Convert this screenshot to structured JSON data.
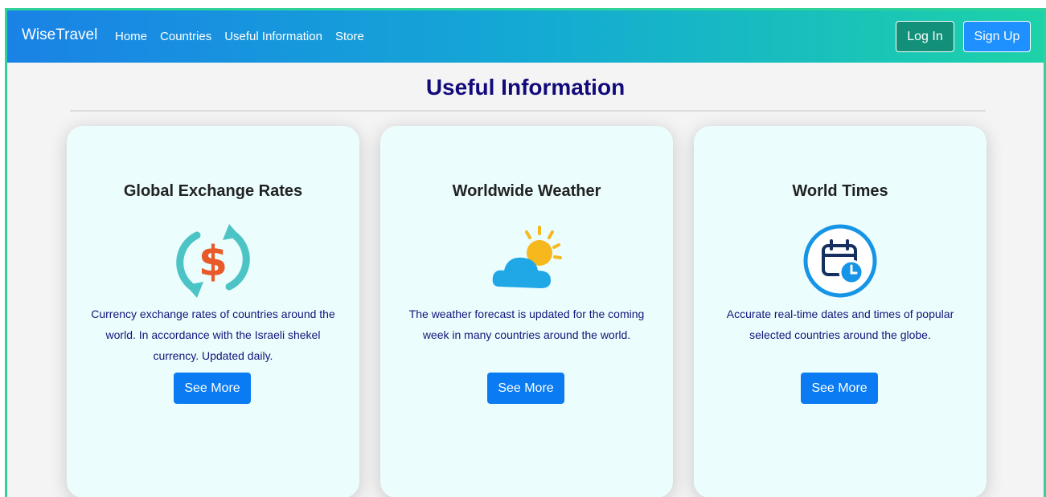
{
  "navbar": {
    "brand": "WiseTravel",
    "links": [
      "Home",
      "Countries",
      "Useful Information",
      "Store"
    ],
    "login_label": "Log In",
    "signup_label": "Sign Up"
  },
  "main": {
    "title": "Useful Information",
    "cards": [
      {
        "title": "Global Exchange Rates",
        "icon": "currency-exchange-icon",
        "description": "Currency exchange rates of countries around the world. In accordance with the Israeli shekel currency. Updated daily.",
        "button_label": "See More"
      },
      {
        "title": "Worldwide Weather",
        "icon": "weather-icon",
        "description": "The weather forecast is updated for the coming week in many countries around the world.",
        "button_label": "See More"
      },
      {
        "title": "World Times",
        "icon": "calendar-clock-icon",
        "description": "Accurate real-time dates and times of popular selected countries around the globe.",
        "button_label": "See More"
      }
    ]
  },
  "colors": {
    "nav_gradient_start": "#1a82e6",
    "nav_gradient_end": "#1dd2a8",
    "title_color": "#120a7a",
    "button_blue": "#0a7bf2",
    "login_teal": "#12907a",
    "card_bg": "#ebfdfd"
  }
}
